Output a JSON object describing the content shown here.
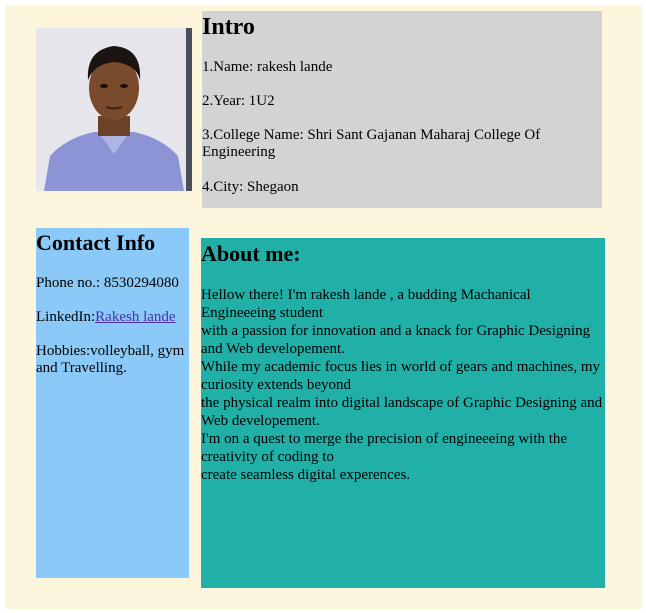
{
  "photo": {
    "alt": "profile photo"
  },
  "intro": {
    "title": "Intro",
    "items": [
      "1.Name: rakesh lande",
      "2.Year: 1U2",
      "3.College Name: Shri Sant Gajanan Maharaj College Of Engineering",
      "4.City: Shegaon"
    ]
  },
  "contact": {
    "title": "Contact Info",
    "phone": "Phone no.: 8530294080",
    "linkedin_label": "LinkedIn:",
    "linkedin_link": "Rakesh lande",
    "hobbies": "Hobbies:volleyball, gym and Travelling."
  },
  "about": {
    "title": "About me:",
    "lines": [
      "Hellow there! I'm rakesh lande , a budding Machanical Engineeeing student",
      "with a passion for innovation and a knack for Graphic Designing and Web developement.",
      "While my academic focus lies in world of gears and machines, my curiosity extends beyond",
      "the physical realm into digital landscape of Graphic Designing and Web developement.",
      "I'm on a quest to merge the precision of engineeeing with the creativity of coding to",
      "create seamless digital experences."
    ]
  },
  "colors": {
    "page_bg": "#fdf6dd",
    "intro_bg": "#d3d3d3",
    "contact_bg": "#8bcaf8",
    "about_bg": "#20b0a8",
    "link": "#4b2fa8"
  }
}
